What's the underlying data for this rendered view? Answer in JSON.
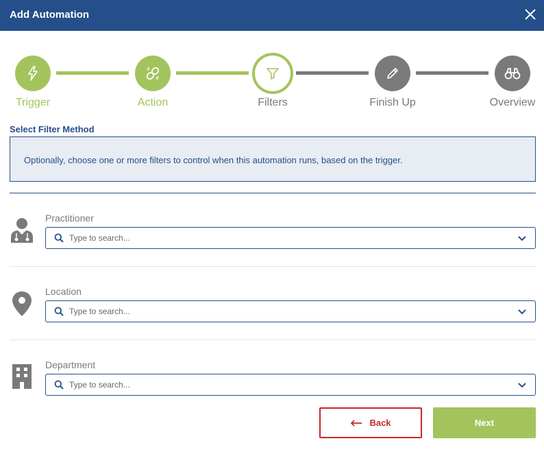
{
  "dialog": {
    "title": "Add Automation",
    "close_icon": "close-icon"
  },
  "steps": [
    {
      "label": "Trigger",
      "state": "done",
      "icon": "lightning-icon"
    },
    {
      "label": "Action",
      "state": "done",
      "icon": "link-icon"
    },
    {
      "label": "Filters",
      "state": "active",
      "icon": "funnel-icon"
    },
    {
      "label": "Finish Up",
      "state": "todo",
      "icon": "pencil-icon"
    },
    {
      "label": "Overview",
      "state": "todo",
      "icon": "binoculars-icon"
    }
  ],
  "section": {
    "title": "Select Filter Method",
    "info": "Optionally, choose one or more filters to control when this automation runs, based on the trigger."
  },
  "filters": [
    {
      "label": "Practitioner",
      "placeholder": "Type to search...",
      "icon": "doctor-icon"
    },
    {
      "label": "Location",
      "placeholder": "Type to search...",
      "icon": "map-pin-icon"
    },
    {
      "label": "Department",
      "placeholder": "Type to search...",
      "icon": "building-icon"
    }
  ],
  "buttons": {
    "back_label": "Back",
    "next_label": "Next"
  },
  "colors": {
    "header": "#254f8a",
    "accent_green": "#a3c45d",
    "inactive_gray": "#7a7a7a",
    "back_red": "#c62828",
    "info_bg": "#e8ecf3"
  }
}
